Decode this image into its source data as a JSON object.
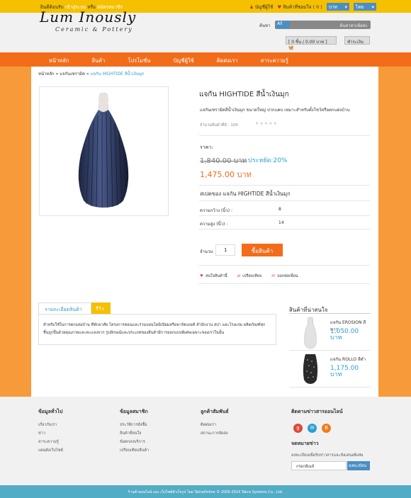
{
  "topbar": {
    "welcome": "ยินดีต้อนรับ",
    "login": "เข้าสู่ระบบ",
    "or": "หรือ",
    "register": "สมัครสมาชิก",
    "account": "บัญชีผู้ใช้",
    "wishlist": "สินค้าที่ชอบใจ ( 0 )",
    "currency": "บาท",
    "language": "ไทย"
  },
  "header": {
    "logo": "Lum Inously",
    "logo_sub": "Ceramic & Pottery",
    "search_label": "ค้นหา",
    "search_scope": "All",
    "search_placeholder": "ค้นหาคาเพ้อค่ะ",
    "cart": "[ 0 ชิ้น / 0.00 บาท ]",
    "checkout": "ชำระเงิน"
  },
  "nav": [
    "หน้าหลัก",
    "สินค้า",
    "โปรโมชั่น",
    "บัญชีผู้ใช้",
    "ติดต่อเรา",
    "สาระความรู้"
  ],
  "breadcrumb": {
    "home": "หน้าหลัก",
    "category": "แจกันเซรามิค",
    "current": "แจกัน HIGHTIDE สีน้ำเงินมุก"
  },
  "product": {
    "title": "แจกัน HIGHTIDE สีน้ำเงินมุก",
    "desc": "แจกันเซรามิคสีน้ำเงินมุก ขนาดใหญ่ ปากแคบ เหมาะสำหรับตั้งโชว์หรือตกแต่งบ้าน",
    "stock": "จำนวนสินค้าที่มี : 100",
    "rating": 0,
    "price_label": "ราคา:",
    "old_price": "1,840.00 บาท",
    "save": "ประหยัด:20%",
    "price": "1,475.00 บาท",
    "spec_title": "สเปคของ แจกัน HIGHTIDE สีน้ำเงินมุก",
    "specs": [
      {
        "name": "ความกว้าง (นิ้ว) :",
        "value": "8"
      },
      {
        "name": "ความสูง (นิ้ว) :",
        "value": "14"
      }
    ],
    "qty_label": "จำนวน",
    "qty": "1",
    "buy": "ซื้อสินค้า",
    "actions": [
      "สนใจสินค้านี้",
      "เปรียบเทียบ",
      "บอกต่อเพื่อน"
    ]
  },
  "tabs": {
    "detail": "รายละเอียดสินค้า",
    "review": "รีวิว",
    "text": "สำหรับใช้ในการตกแต่งบ้าน ที่พักอาศัย โครงการคอนเเละร่วมบอนโดมิเนียมหรือพาร์ตเมนท์ สำนักงาน สปา และโรงแรม ผลิตภัณฑ์ทุกชิ้นถูกปั้นด้วยคุณภาพเเละทะเเลงจาก รูปลักษณ์และประเภทของสินค้ามีการออกแบบพิเศษเฉพาะของเราในนั้น"
  },
  "related": {
    "title": "สินค้าที่น่าสนใจ",
    "items": [
      {
        "name": "แจกัน EROSION สีขาว",
        "price": "1,050.00 บาท"
      },
      {
        "name": "แจกัน ROLLO สีดำ",
        "price": "1,175.00 บาท"
      }
    ]
  },
  "footer": {
    "col1": {
      "title": "ข้อมูลทั่วไป",
      "links": [
        "เกี่ยวกับเรา",
        "ข่าว",
        "สาระความรู้",
        "แผนผังเว็บไซต์"
      ]
    },
    "col2": {
      "title": "ข้อมูลสมาชิก",
      "links": [
        "ประวัติการสั่งซื้อ",
        "สินค้าที่สนใจ",
        "ข้อตกลงบริการ",
        "เปรียบเทียบสินค้า"
      ]
    },
    "col3": {
      "title": "ลูกค้าสัมพันธ์",
      "links": [
        "ติดต่อเรา",
        "สถานะการจัดส่ง"
      ]
    },
    "col4": {
      "title": "ติดตามข่าวสารออนไลน์"
    },
    "newsletter_title": "จดหมายข่าว",
    "newsletter_desc": "ลงทะเบียนเพื่อรับข่าวสารและข้อเสนอพิเศษ",
    "newsletter_placeholder": "กรอกอีเมล์",
    "newsletter_button": "ลงทะเบียน",
    "bottom": "ร้านค้าออนไลน์ และ เว็บไซต์สำเร็จรูป โดย TakraOnline © 2006-2014 Takra Systems Co., Ltd."
  },
  "colors": {
    "accent": "#f26c1a",
    "topbar": "#f5c000",
    "link": "#2ea0c9",
    "footer_bar": "#52acc5"
  }
}
